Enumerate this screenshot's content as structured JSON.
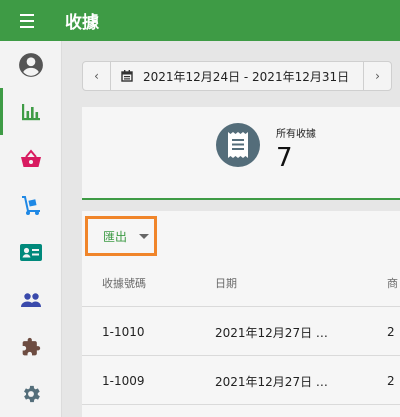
{
  "header": {
    "title": "收據"
  },
  "sidebar": {
    "items": [
      {
        "name": "account",
        "icon": "account-circle-icon",
        "color": "#555555"
      },
      {
        "name": "reports",
        "icon": "bar-chart-icon",
        "color": "#3e9b45",
        "active": true
      },
      {
        "name": "sales",
        "icon": "shopping-basket-icon",
        "color": "#d81b60"
      },
      {
        "name": "inventory",
        "icon": "dolly-icon",
        "color": "#1e88e5"
      },
      {
        "name": "customers",
        "icon": "contact-card-icon",
        "color": "#00897b"
      },
      {
        "name": "employees",
        "icon": "people-icon",
        "color": "#3949ab"
      },
      {
        "name": "addons",
        "icon": "puzzle-icon",
        "color": "#6d4c41"
      },
      {
        "name": "settings",
        "icon": "gear-icon",
        "color": "#546e7a"
      }
    ]
  },
  "date_range": {
    "prev": "‹",
    "next": "›",
    "label": "2021年12月24日 - 2021年12月31日"
  },
  "summary": {
    "label": "所有收據",
    "value": "7"
  },
  "table": {
    "export_label": "匯出",
    "columns": [
      "收據號碼",
      "日期",
      "商"
    ],
    "rows": [
      [
        "1-1010",
        "2021年12月27日 …",
        "2 "
      ],
      [
        "1-1009",
        "2021年12月27日 …",
        "2 "
      ]
    ]
  },
  "colors": {
    "brand": "#3e9b45",
    "export_highlight": "#f0852a"
  }
}
